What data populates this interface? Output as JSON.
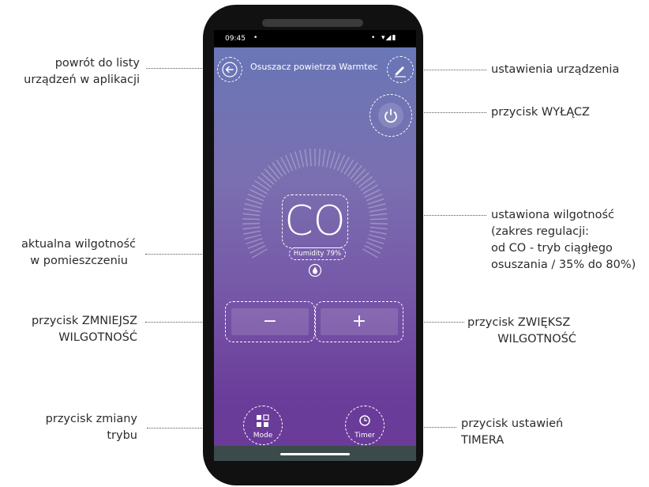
{
  "status_bar": {
    "time": "09:45",
    "dot_left": "•",
    "dot_right": "•",
    "system_icons": "▾◢▮"
  },
  "app": {
    "device_title": "Osuszacz powietrza Warmtec",
    "humidity_setpoint": "CO",
    "current_humidity": "Humidity 79%",
    "minus_label": "−",
    "plus_label": "+",
    "mode_label": "Mode",
    "timer_label": "Timer"
  },
  "annotations": {
    "back_line1": "powrót do listy",
    "back_line2": "urządzeń w aplikacji",
    "edit": "ustawienia urządzenia",
    "power": "przycisk WYŁĄCZ",
    "setpoint_line1": "ustawiona wilgotność",
    "setpoint_line2": "(zakres regulacji:",
    "setpoint_line3": "od CO - tryb ciągłego",
    "setpoint_line4": "osuszania / 35% do 80%)",
    "current_line1": "aktualna wilgotność",
    "current_line2": "w pomieszczeniu",
    "decrease_line1": "przycisk ZMNIEJSZ",
    "decrease_line2": "WILGOTNOŚĆ",
    "increase_line1": "przycisk ZWIĘKSZ",
    "increase_line2": "WILGOTNOŚĆ",
    "mode_line1": "przycisk zmiany",
    "mode_line2": "trybu",
    "timer_line1": "przycisk ustawień",
    "timer_line2": "TIMERA"
  },
  "colors": {
    "screen_top": "#6777b7",
    "screen_bottom": "#6a3a97",
    "nav_bar": "#3b4b4b",
    "phone_body": "#111111"
  }
}
